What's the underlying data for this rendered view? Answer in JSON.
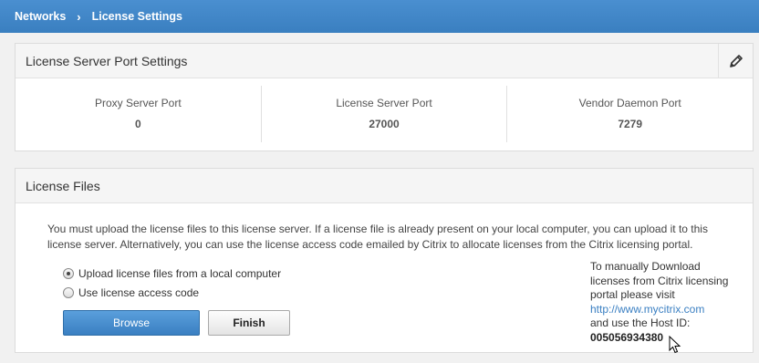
{
  "breadcrumb": {
    "parent": "Networks",
    "separator": "›",
    "current": "License Settings"
  },
  "port_settings": {
    "title": "License Server Port Settings",
    "edit_icon": "pencil-icon",
    "ports": [
      {
        "label": "Proxy Server Port",
        "value": "0"
      },
      {
        "label": "License Server Port",
        "value": "27000"
      },
      {
        "label": "Vendor Daemon Port",
        "value": "7279"
      }
    ]
  },
  "license_files": {
    "title": "License Files",
    "description": "You must upload the license files to this license server. If a license file is already present on your local computer, you can upload it to this license server. Alternatively, you can use the license access code emailed by Citrix to allocate licenses from the Citrix licensing portal.",
    "options": [
      {
        "label": "Upload license files from a local computer",
        "selected": true
      },
      {
        "label": "Use license access code",
        "selected": false
      }
    ],
    "browse_label": "Browse",
    "finish_label": "Finish",
    "manual_text": "To manually Download licenses from Citrix licensing portal please visit",
    "manual_link": "http://www.mycitrix.com",
    "host_text": "and use the Host ID:",
    "host_id": "005056934380"
  },
  "colors": {
    "topbar": "#3d85c6",
    "primary_button": "#3a7fc2",
    "link": "#3a7fc2"
  }
}
